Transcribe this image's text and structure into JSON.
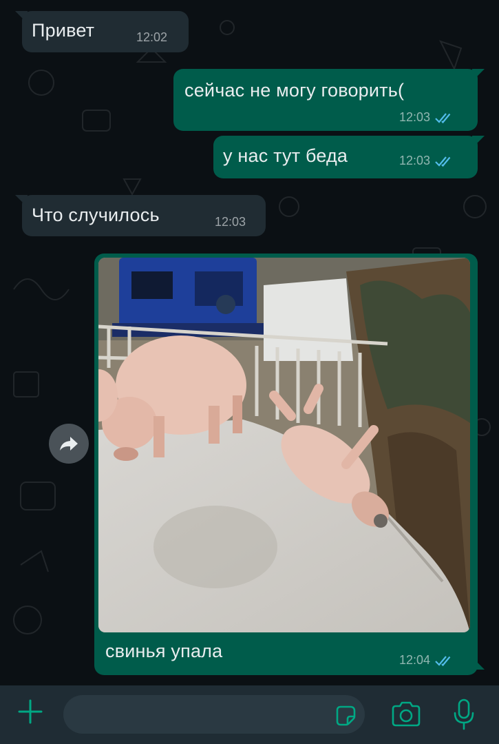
{
  "messages": [
    {
      "direction": "incoming",
      "text": "Привет",
      "time": "12:02"
    },
    {
      "direction": "outgoing",
      "text": "сейчас не могу говорить(",
      "time": "12:03",
      "status": "read"
    },
    {
      "direction": "outgoing",
      "text": "у нас тут беда",
      "time": "12:03",
      "status": "read"
    },
    {
      "direction": "incoming",
      "text": "Что случилось",
      "time": "12:03"
    },
    {
      "direction": "outgoing",
      "type": "image",
      "caption": "свинья упала",
      "time": "12:04",
      "status": "read"
    }
  ],
  "composer": {
    "placeholder": ""
  },
  "icons": {
    "forward": "forward-arrow-icon",
    "attach": "plus-icon",
    "sticker": "sticker-icon",
    "camera": "camera-icon",
    "mic": "microphone-icon",
    "read_receipt": "double-check-icon"
  },
  "colors": {
    "background": "#0b1014",
    "incoming_bubble": "#202c33",
    "outgoing_bubble": "#005c4b",
    "accent": "#00a884",
    "read_tick": "#53bdeb"
  }
}
